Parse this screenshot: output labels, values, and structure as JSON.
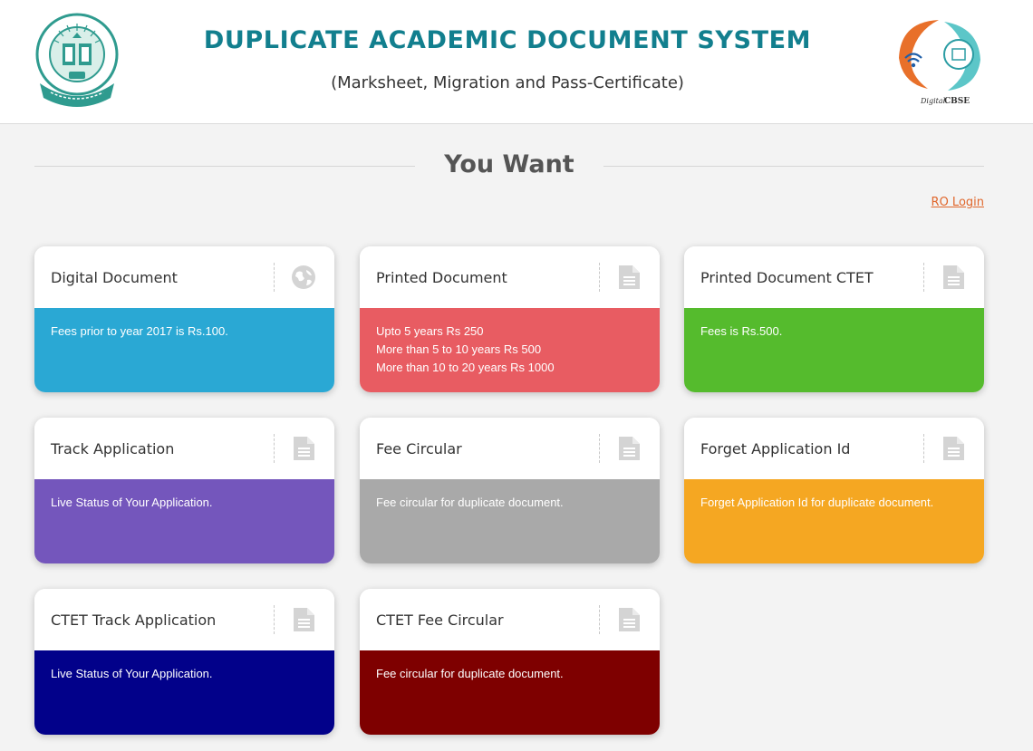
{
  "header": {
    "title": "DUPLICATE ACADEMIC DOCUMENT SYSTEM",
    "subtitle": "(Marksheet, Migration and Pass-Certificate)",
    "left_logo_icon": "cbse-emblem-icon",
    "right_logo_icon": "digital-cbse-logo-icon",
    "right_logo_text_prefix": "Digital",
    "right_logo_text_brand": "CBSE"
  },
  "section": {
    "title": "You Want"
  },
  "ro_login": {
    "label": "RO Login"
  },
  "colors": {
    "title_teal": "#127f8e",
    "link_orange": "#e0662b",
    "digital": "#2aa8d4",
    "printed": "#e85c62",
    "printed_ctet": "#55bb2d",
    "track": "#7456bc",
    "fee_circular": "#a9a9a9",
    "forget_id": "#f5a722",
    "ctet_track": "#02018a",
    "ctet_fee": "#7e0000"
  },
  "cards": [
    {
      "title": "Digital Document",
      "icon": "globe-icon",
      "color": "#2aa8d4",
      "lines": [
        "Fees prior to year 2017 is Rs.100."
      ]
    },
    {
      "title": "Printed Document",
      "icon": "document-icon",
      "color": "#e85c62",
      "lines": [
        "Upto 5 years Rs 250",
        "More than 5 to 10 years Rs 500",
        "More than 10 to 20 years Rs 1000"
      ]
    },
    {
      "title": "Printed Document CTET",
      "icon": "document-icon",
      "color": "#55bb2d",
      "lines": [
        "Fees is Rs.500."
      ]
    },
    {
      "title": "Track Application",
      "icon": "document-icon",
      "color": "#7456bc",
      "lines": [
        "Live Status of Your Application."
      ]
    },
    {
      "title": "Fee Circular",
      "icon": "document-icon",
      "color": "#a9a9a9",
      "lines": [
        "Fee circular for duplicate document."
      ]
    },
    {
      "title": "Forget Application Id",
      "icon": "document-icon",
      "color": "#f5a722",
      "lines": [
        "Forget Application Id for duplicate document."
      ]
    },
    {
      "title": "CTET Track Application",
      "icon": "document-icon",
      "color": "#02018a",
      "lines": [
        "Live Status of Your Application."
      ]
    },
    {
      "title": "CTET Fee Circular",
      "icon": "document-icon",
      "color": "#7e0000",
      "lines": [
        "Fee circular for duplicate document."
      ]
    }
  ]
}
